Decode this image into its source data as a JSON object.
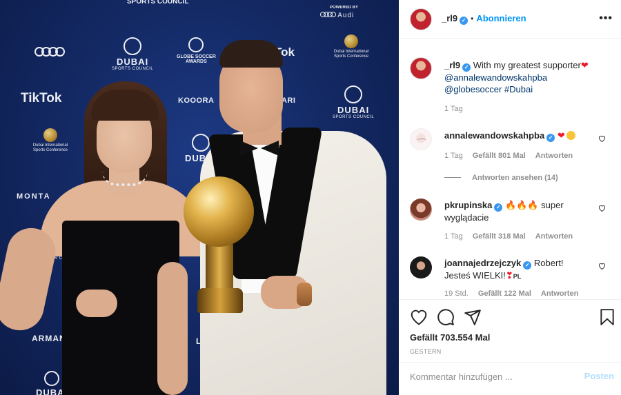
{
  "photo": {
    "backdrop": {
      "top_logo": "SPORTS COUNCIL",
      "powered_by": "POWERED BY",
      "audi": "Audi",
      "dubai": "DUBAI",
      "dubai_sub": "SPORTS COUNCIL",
      "tiktok": "TikTok",
      "tiktok_partial": "Tok",
      "globe_soccer": "GLOBE SOCCER",
      "globe_soccer_sub": "AWARDS",
      "conference": "Dubai International Sports Conference",
      "kooora": "KOOORA",
      "montana": "MONTA",
      "armani": "ARMANI",
      "ari": "ARI",
      "lga": "LGA"
    }
  },
  "header": {
    "username": "_rl9",
    "verified": "✓",
    "separator": "•",
    "follow_label": "Abonnieren",
    "more_label": "•••"
  },
  "caption": {
    "username": "_rl9",
    "text": "With my greatest supporter",
    "emoji": "❤",
    "mentions": [
      "@annalewandowskahpba",
      "@globesoccer"
    ],
    "hashtag": "#Dubai",
    "age": "1 Tag"
  },
  "comments": [
    {
      "username": "annalewandowskahpba",
      "verified": true,
      "text": "",
      "emojis": "❤",
      "age": "1 Tag",
      "likes": "Gefällt 801 Mal",
      "reply_label": "Antworten",
      "view_replies": "Antworten ansehen (14)"
    },
    {
      "username": "pkrupinska",
      "verified": true,
      "emojis": "🔥🔥🔥",
      "text_line1": "super",
      "text_line2": "wyglądacie",
      "age": "1 Tag",
      "likes": "Gefällt 318 Mal",
      "reply_label": "Antworten"
    },
    {
      "username": "joannajedrzejczyk",
      "verified": true,
      "text_line1": "Robert!",
      "text_line2": "Jesteś WIELKI!",
      "emojis": "❣",
      "flag": "PL",
      "age": "19 Std.",
      "likes": "Gefällt 122 Mal",
      "reply_label": "Antworten"
    }
  ],
  "actions": {
    "likes": "Gefällt 703.554 Mal",
    "date": "GESTERN",
    "comment_placeholder": "Kommentar hinzufügen ...",
    "post_label": "Posten"
  },
  "icons": [
    "heart-icon",
    "comment-icon",
    "share-icon",
    "bookmark-icon",
    "more-icon",
    "verified-icon"
  ],
  "colors": {
    "accent": "#0095f6",
    "verified": "#3897f0",
    "muted": "#8e8e8e",
    "post_disabled": "#b2dffc",
    "backdrop": "#142a66"
  }
}
